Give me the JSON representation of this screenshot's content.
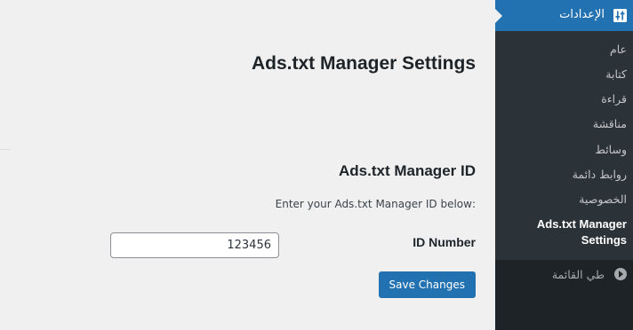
{
  "content": {
    "page_title": "Ads.txt Manager Settings",
    "section_title": "Ads.txt Manager ID",
    "section_description": ":Enter your Ads.txt Manager ID below",
    "field_label": "ID Number",
    "id_value": "123456",
    "save_label": "Save Changes"
  },
  "sidebar": {
    "header_label": "الإعدادات",
    "header_icon": "settings-sliders-icon",
    "items": [
      {
        "label": "عام"
      },
      {
        "label": "كتابة"
      },
      {
        "label": "قراءة"
      },
      {
        "label": "مناقشة"
      },
      {
        "label": "وسائط"
      },
      {
        "label": "روابط دائمة"
      },
      {
        "label": "الخصوصية"
      },
      {
        "label": "Ads.txt Manager Settings"
      }
    ],
    "collapse_label": "طي القائمة",
    "collapse_icon": "collapse-play-icon"
  },
  "colors": {
    "accent": "#2271b1",
    "sidebar_bg": "#1d2327",
    "submenu_bg": "#2c3338",
    "page_bg": "#f0f0f1"
  }
}
